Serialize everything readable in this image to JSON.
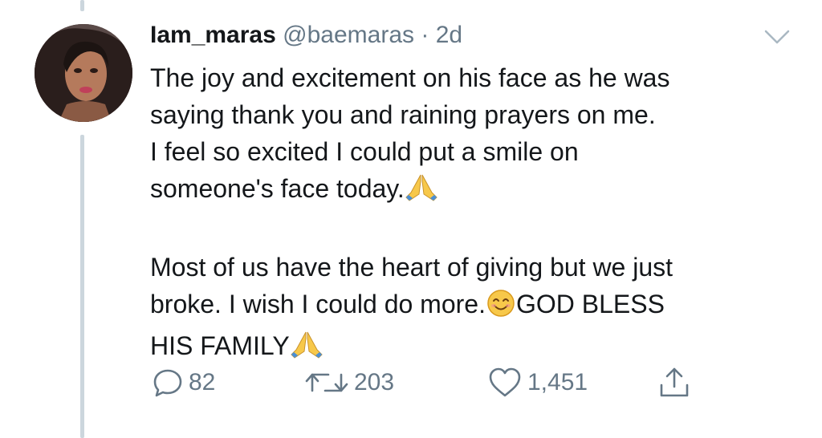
{
  "tweet": {
    "display_name": "Iam_maras",
    "handle": "@baemaras",
    "separator": "·",
    "time": "2d",
    "body": {
      "paragraph1": {
        "line1": "The joy and excitement on his face as he was",
        "line2": "saying thank you and raining prayers on me.",
        "line3": "I feel so excited I could put a smile on",
        "line4": "someone's face today."
      },
      "paragraph2": {
        "line1": "Most of us have the heart of giving but we just",
        "line2a": "broke. I wish I could do more.",
        "line2b": "GOD BLESS",
        "line3": "HIS FAMILY"
      }
    },
    "emojis": [
      "folded-hands",
      "smiling-face",
      "folded-hands"
    ],
    "actions": {
      "reply_count": "82",
      "retweet_count": "203",
      "like_count": "1,451"
    },
    "icons": {
      "reply": "reply-icon",
      "retweet": "retweet-icon",
      "like": "heart-icon",
      "share": "share-icon",
      "menu": "chevron-down-icon"
    },
    "colors": {
      "text": "#14171a",
      "secondary": "#657786",
      "thread_line": "#ccd6dd",
      "emoji_yellow": "#f7c84a"
    }
  }
}
